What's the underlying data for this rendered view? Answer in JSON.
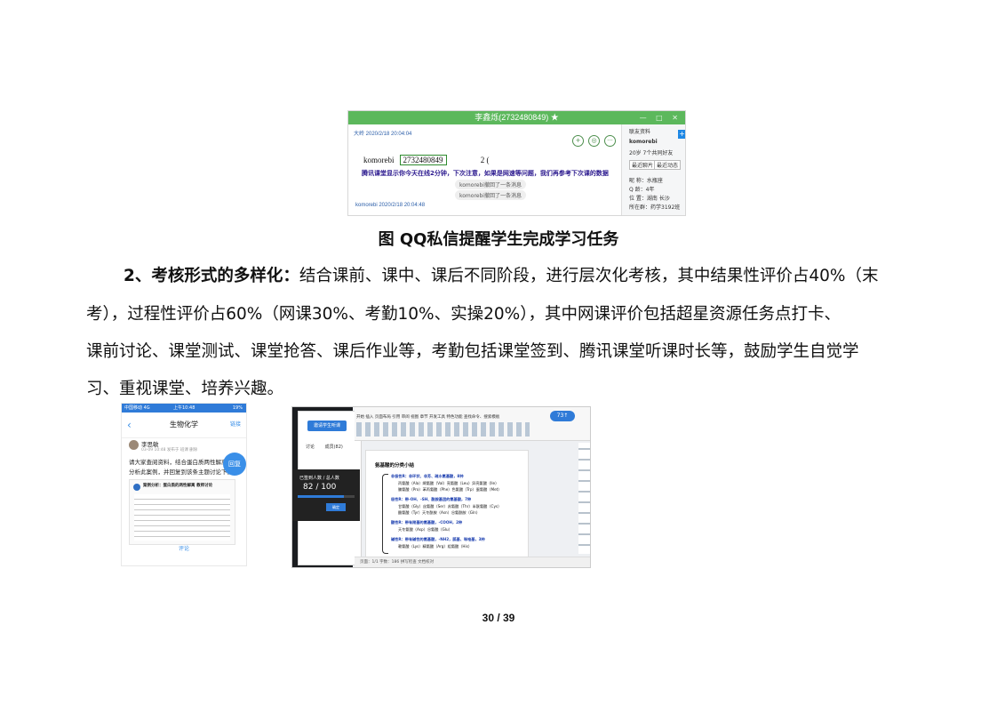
{
  "qq_screenshot": {
    "window_title": "李鑫烁(2732480849) ★",
    "window_controls": "— □ ✕",
    "toolbar_icons": [
      "add-friend-icon",
      "group-icon",
      "more-icon"
    ],
    "more_label": "···",
    "msg1_time": "大岭 2020/2/18 20:04:04",
    "msg1_name": "komorebi",
    "msg1_qq": "2732480849",
    "msg1_num": "2 (",
    "notice": "腾讯课堂显示你今天在线2分钟，下次注意，如果是网速等问题，我们再参考下次课的数据",
    "recall1": "komorebi撤回了一条消息",
    "recall2": "komorebi撤回了一条消息",
    "msg2_time": "komorebi 2020/2/18 20:04:48",
    "side_header": "联友资料",
    "side_name": "komorebi",
    "side_tag": "20岁 7个共同好友",
    "side_btn1": "最近聊片",
    "side_btn2": "最近动态",
    "side_row1": "昵 称：水瓶座",
    "side_row2": "Q 龄：4年",
    "side_row3": "位 置：湖南 长沙",
    "side_row4": "所在群：药学3192班"
  },
  "caption": "图  QQ私信提醒学生完成学习任务",
  "paragraph": {
    "line1_bold": "2、考核形式的多样化：",
    "line1_rest": "结合课前、课中、课后不同阶段，进行层次化考核，其中结果性评价占40%（末",
    "line2": "考），过程性评价占60%（网课30%、考勤10%、实操20%），其中网课评价包括超星资源任务点打卡、",
    "line3": "课前讨论、课堂测试、课堂抢答、课后作业等，考勤包括课堂签到、腾讯课堂听课时长等，鼓励学生自觉学",
    "line4": "习、重视课堂、培养兴趣。"
  },
  "phone_screenshot": {
    "status_left": "中国移动 4G",
    "status_time": "上午10:48",
    "status_right": "19%",
    "back": "‹",
    "title": "生物化学",
    "right_link": "链接",
    "user": "李思敏",
    "meta": "03-09 10:48 发布于 班课 删除",
    "text1": "请大家查阅资料，结合蛋白质两性解离",
    "text2": "分析此案例，并回复到该条主题讨论下。",
    "card_title": "案例分析：蛋白质的两性解离  教师讨论",
    "bubble": "回复",
    "footer": "评论"
  },
  "desktop_screenshot": {
    "panel_button": "邀请学生听课",
    "panel_tabs": "讨论  成员(82)",
    "popup_line1": "已签到人数 / 总人数",
    "popup_count": "82 / 100",
    "signin_done": 82,
    "signin_total": 100,
    "popup_btn": "确定",
    "ribbon_tabs": "开始  插入  页面布局  引用  审阅  视图  章节  开发工具  特色功能  查找命令、搜索模板",
    "badge": "73↑",
    "doc_title": "氨基酸的分类小结",
    "groups": [
      {
        "head": "非极性R：非环状、非芳、疏水氨基酸，8种",
        "items": [
          "丙氨酸（Ala）缬氨酸（Val）亮氨酸（Leu）异亮氨酸（Ile）",
          "脯氨酸（Pro）苯丙氨酸（Phe）色氨酸（Trp）蛋氨酸（Met）"
        ]
      },
      {
        "head": "极性R：带-OH、-SH、酰胺基团的氨基酸，7种",
        "items": [
          "甘氨酸（Gly）丝氨酸（Ser）苏氨酸（Thr）半胱氨酸（Cys）",
          "酪氨酸（Tyr）天冬酰胺（Asn）谷氨酰胺（Gln）"
        ]
      },
      {
        "head": "酸性R：带有羧基的氨基酸，-COOH，2种",
        "items": [
          "天冬氨酸（Asp）谷氨酸（Glu）"
        ]
      },
      {
        "head": "碱性R：带有碱性的氨基酸，-NH2，胍基、咪唑基，3种",
        "items": [
          "赖氨酸（Lys）精氨酸（Arg）组氨酸（His）"
        ]
      }
    ],
    "statusbar": "页面：1/1  字数：186  拼写检查  文档校对"
  },
  "page_number": "30 / 39"
}
